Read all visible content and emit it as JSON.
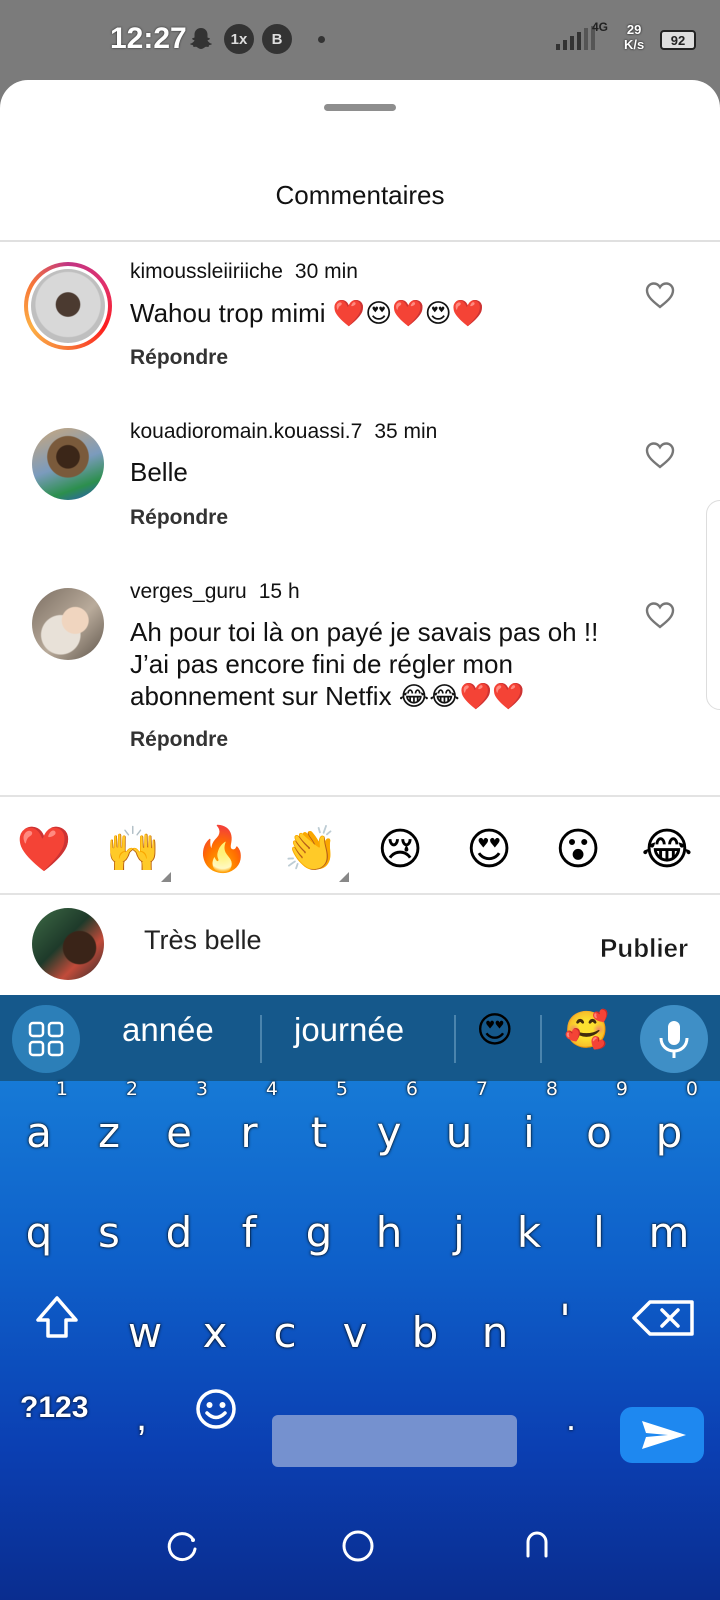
{
  "status_bar": {
    "time": "12:27",
    "icons": [
      "snapchat-icon",
      "1x-app-icon",
      "b-app-icon",
      "notification-dot"
    ],
    "network": "4G",
    "speed_value": "29",
    "speed_unit": "K/s",
    "battery": "92"
  },
  "sheet": {
    "title": "Commentaires"
  },
  "comments": [
    {
      "username": "kimoussleiiriiche",
      "time": "30 min",
      "text": "Wahou trop mimi ❤️😍❤️😍❤️",
      "reply_label": "Répondre",
      "has_story_ring": true
    },
    {
      "username": "kouadioromain.kouassi.7",
      "time": "35 min",
      "text": "Belle",
      "reply_label": "Répondre",
      "has_story_ring": false
    },
    {
      "username": "verges_guru",
      "time": "15 h",
      "text": "Ah pour toi là on payé je savais pas oh !! J’ai pas encore fini de régler mon abonnement sur Netfix 😂😂❤️❤️",
      "reply_label": "Répondre",
      "has_story_ring": false
    }
  ],
  "quick_reactions": [
    "❤️",
    "🙌",
    "🔥",
    "👏",
    "😢",
    "😍",
    "😮",
    "😂"
  ],
  "composer": {
    "value": "Très belle",
    "publish_label": "Publier"
  },
  "keyboard": {
    "suggestions": [
      "année",
      "journée"
    ],
    "suggestion_emojis": [
      "😍",
      "🥰"
    ],
    "row1": [
      {
        "letter": "a",
        "num": "1"
      },
      {
        "letter": "z",
        "num": "2"
      },
      {
        "letter": "e",
        "num": "3"
      },
      {
        "letter": "r",
        "num": "4"
      },
      {
        "letter": "t",
        "num": "5"
      },
      {
        "letter": "y",
        "num": "6"
      },
      {
        "letter": "u",
        "num": "7"
      },
      {
        "letter": "i",
        "num": "8"
      },
      {
        "letter": "o",
        "num": "9"
      },
      {
        "letter": "p",
        "num": "0"
      }
    ],
    "row2": [
      "q",
      "s",
      "d",
      "f",
      "g",
      "h",
      "j",
      "k",
      "l",
      "m"
    ],
    "row3": [
      "w",
      "x",
      "c",
      "v",
      "b",
      "n",
      "'"
    ],
    "symbols_label": "?123",
    "comma": ",",
    "period": "."
  },
  "colors": {
    "story_ring": "#e1306c",
    "keyboard_top": "#1a86dc",
    "keyboard_bottom": "#0a2d8f",
    "send_button": "#1e88f0"
  }
}
